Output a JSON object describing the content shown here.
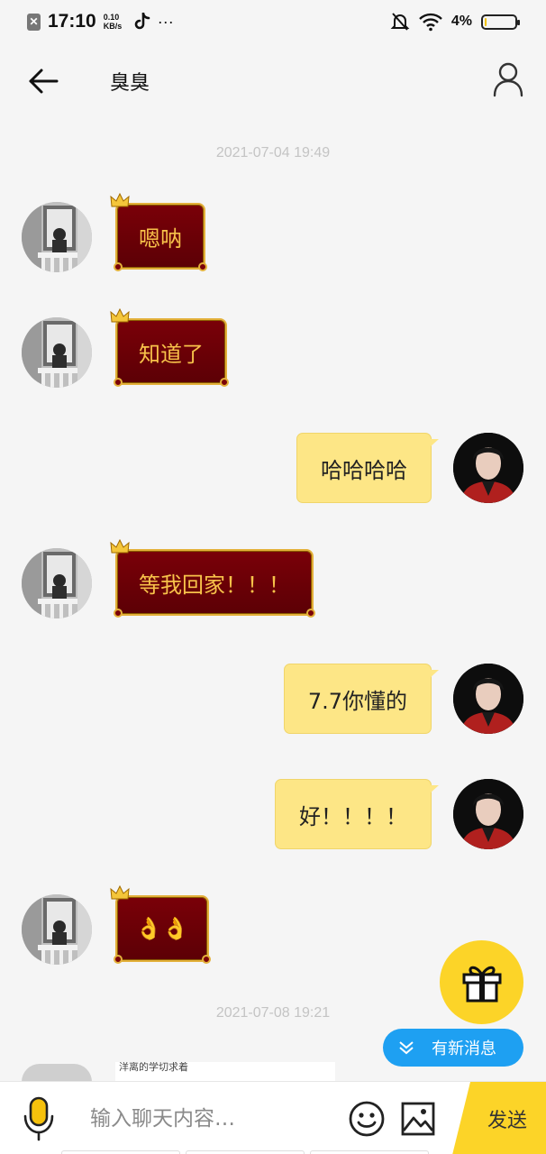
{
  "status_bar": {
    "time": "17:10",
    "speed_value": "0.10",
    "speed_unit": "KB/s",
    "more": "···",
    "battery": "4%",
    "battery_level": 0.04
  },
  "header": {
    "title": "臭臭"
  },
  "timestamps": [
    "2021-07-04 19:49",
    "2021-07-08 19:21"
  ],
  "messages": [
    {
      "side": "left",
      "text": "嗯呐"
    },
    {
      "side": "left",
      "text": "知道了"
    },
    {
      "side": "right",
      "text": "哈哈哈哈"
    },
    {
      "side": "left",
      "text": "等我回家！！！"
    },
    {
      "side": "right",
      "text": "7.7你懂的"
    },
    {
      "side": "right",
      "text": "好！！！！"
    },
    {
      "side": "left",
      "text": "👌👌"
    }
  ],
  "partial_message": "洋离的学切求着",
  "new_message_pill": "有新消息",
  "input": {
    "placeholder": "输入聊天内容…",
    "value": ""
  },
  "send_label": "发送",
  "colors": {
    "accent": "#fcd428",
    "bubble_red": "#6b0006",
    "bubble_gold": "#e3b03a",
    "bubble_yellow": "#fde686",
    "pill_blue": "#1ea0f2"
  }
}
